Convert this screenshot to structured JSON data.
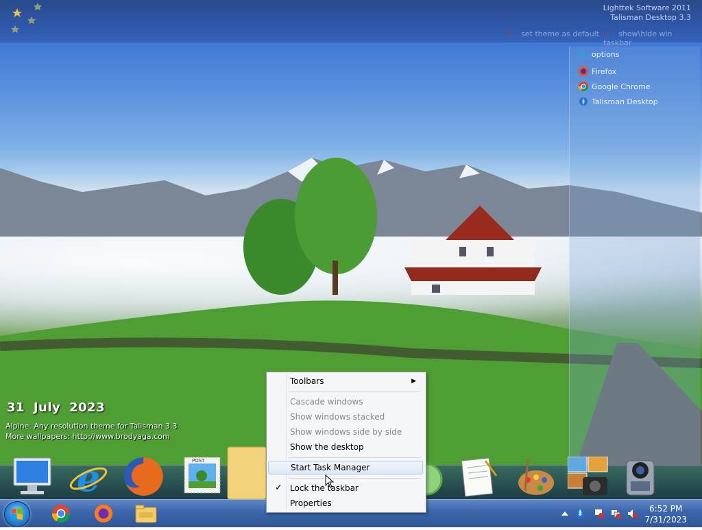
{
  "top_bar": {
    "brand_line1": "Lighttek Software 2011",
    "brand_line2": "Talisman Desktop 3.3",
    "set_theme_default": "set theme as default",
    "show_hide_taskbar": "show\\hide win taskbar"
  },
  "launcher": {
    "items": [
      {
        "label": "options",
        "icon": "play-arrow-icon"
      },
      {
        "label": "Firefox",
        "icon": "firefox-icon"
      },
      {
        "label": "Google Chrome",
        "icon": "chrome-icon"
      },
      {
        "label": "Talisman Desktop",
        "icon": "talisman-icon"
      }
    ]
  },
  "desktop": {
    "date": "31  July  2023",
    "caption_line1": "Alpine. Any resolution theme for Talisman 3.3",
    "caption_line2": "More wallpapers: http://www.brodyaga.com"
  },
  "context_menu": {
    "toolbars": "Toolbars",
    "cascade": "Cascade windows",
    "stacked": "Show windows stacked",
    "side_by_side": "Show windows side by side",
    "show_desktop": "Show the desktop",
    "task_manager": "Start Task Manager",
    "lock_taskbar": "Lock the taskbar",
    "properties": "Properties",
    "check_glyph": "✓",
    "submenu_glyph": "▶"
  },
  "taskbar": {
    "time": "6:52 PM",
    "date": "7/31/2023"
  },
  "colors": {
    "taskbar": "#3d68ad",
    "menu_bg": "#f5f6f7",
    "highlight_border": "#a8c8ec"
  }
}
